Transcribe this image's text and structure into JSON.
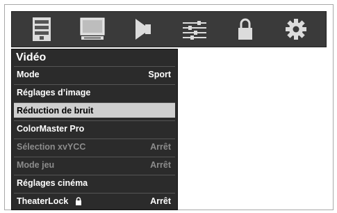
{
  "tabs": [
    {
      "icon": "list-icon"
    },
    {
      "icon": "monitor-icon"
    },
    {
      "icon": "speaker-icon"
    },
    {
      "icon": "sliders-icon"
    },
    {
      "icon": "lock-icon"
    },
    {
      "icon": "gear-icon"
    }
  ],
  "menu": {
    "title": "Vidéo",
    "items": [
      {
        "label": "Mode",
        "value": "Sport",
        "state": "normal"
      },
      {
        "label": "Réglages d’image",
        "value": "",
        "state": "normal"
      },
      {
        "label": "Réduction de bruit",
        "value": "",
        "state": "selected"
      },
      {
        "label": "ColorMaster Pro",
        "value": "",
        "state": "normal"
      },
      {
        "label": "Sélection xvYCC",
        "value": "Arrêt",
        "state": "disabled"
      },
      {
        "label": "Mode jeu",
        "value": "Arrêt",
        "state": "disabled"
      },
      {
        "label": "Réglages cinéma",
        "value": "",
        "state": "normal"
      },
      {
        "label": "TheaterLock",
        "value": "Arrêt",
        "state": "normal",
        "icon": "lock-icon"
      }
    ]
  },
  "colors": {
    "selected_bg": "#cfcfcf",
    "menu_bg": "#2b2b2b",
    "disabled_text": "#8c8c8c"
  }
}
